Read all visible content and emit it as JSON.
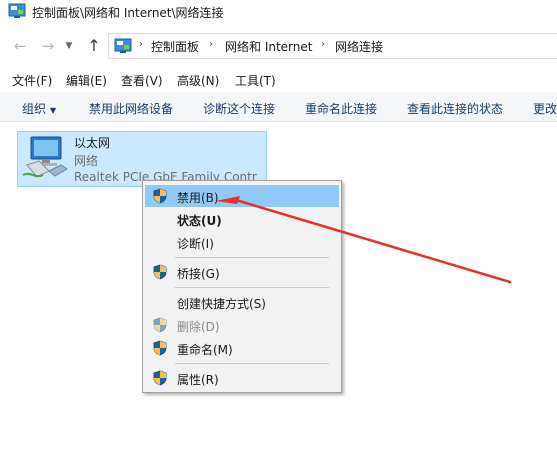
{
  "window": {
    "title": "控制面板\\网络和 Internet\\网络连接"
  },
  "address": {
    "crumbs": [
      "控制面板",
      "网络和 Internet",
      "网络连接"
    ]
  },
  "menubar": {
    "items": [
      "文件(F)",
      "编辑(E)",
      "查看(V)",
      "高级(N)",
      "工具(T)"
    ]
  },
  "commandbar": {
    "items": [
      "组织",
      "禁用此网络设备",
      "诊断这个连接",
      "重命名此连接",
      "查看此连接的状态",
      "更改"
    ]
  },
  "adapter": {
    "name": "以太网",
    "status": "网络",
    "device": "Realtek PCIe GbE Family Contr"
  },
  "context_menu": {
    "items": [
      {
        "label": "禁用(B)",
        "shield": true,
        "highlighted": true,
        "bold": false,
        "disabled": false
      },
      {
        "label": "状态(U)",
        "shield": false,
        "highlighted": false,
        "bold": true,
        "disabled": false
      },
      {
        "label": "诊断(I)",
        "shield": false,
        "highlighted": false,
        "bold": false,
        "disabled": false
      },
      {
        "label": "桥接(G)",
        "shield": true,
        "highlighted": false,
        "bold": false,
        "disabled": false
      },
      {
        "label": "创建快捷方式(S)",
        "shield": false,
        "highlighted": false,
        "bold": false,
        "disabled": false
      },
      {
        "label": "删除(D)",
        "shield": true,
        "highlighted": false,
        "bold": false,
        "disabled": true
      },
      {
        "label": "重命名(M)",
        "shield": true,
        "highlighted": false,
        "bold": false,
        "disabled": false
      },
      {
        "label": "属性(R)",
        "shield": true,
        "highlighted": false,
        "bold": false,
        "disabled": false
      }
    ]
  },
  "icons": {
    "back": "back-arrow-icon",
    "forward": "forward-arrow-icon",
    "up": "up-arrow-icon",
    "shield": "uac-shield-icon",
    "adapter": "network-adapter-icon",
    "folder": "control-panel-icon"
  },
  "colors": {
    "selection": "#cce8ff",
    "menu_highlight": "#91c9f7",
    "annotation_arrow": "#e8312a",
    "command_text": "#1a3c6e"
  }
}
